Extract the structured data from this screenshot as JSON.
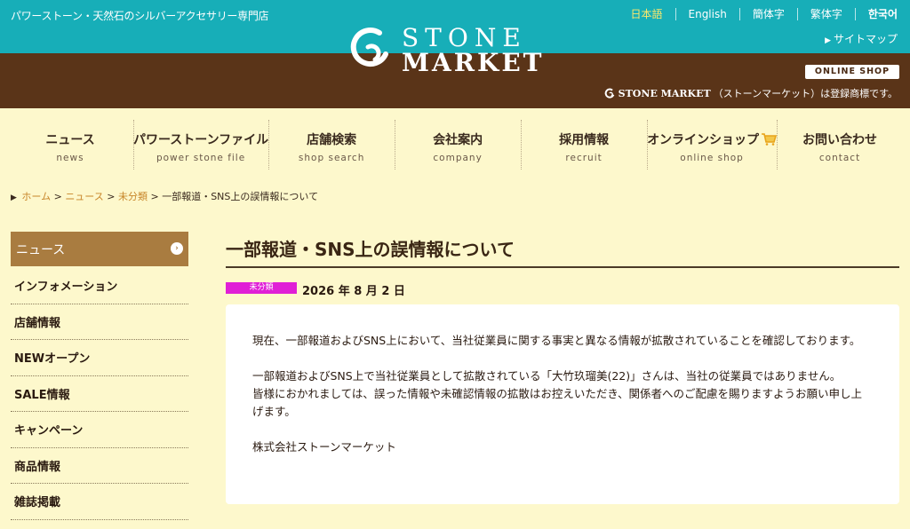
{
  "header": {
    "tagline": "パワーストーン・天然石のシルバーアクセサリー専門店",
    "languages": [
      "日本語",
      "English",
      "簡体字",
      "繁体字",
      "한국어"
    ],
    "sitemap": "サイトマップ",
    "logo_line1": "STONE",
    "logo_line2": "MARKET",
    "online_shop": "ONLINE SHOP",
    "trademark_logo": "STONE MARKET",
    "trademark_text": "（ストーンマーケット）は登録商標です。"
  },
  "nav": [
    {
      "jp": "ニュース",
      "en": "news"
    },
    {
      "jp": "パワーストーンファイル",
      "en": "power stone file"
    },
    {
      "jp": "店舗検索",
      "en": "shop search"
    },
    {
      "jp": "会社案内",
      "en": "company"
    },
    {
      "jp": "採用情報",
      "en": "recruit"
    },
    {
      "jp": "オンラインショップ",
      "en": "online shop"
    },
    {
      "jp": "お問い合わせ",
      "en": "contact"
    }
  ],
  "breadcrumb": {
    "home": "ホーム",
    "news": "ニュース",
    "category": "未分類",
    "current": "一部報道・SNS上の誤情報について",
    "separator": ">"
  },
  "sidebar": {
    "active": "ニュース",
    "items": [
      "インフォメーション",
      "店舗情報",
      "NEWオープン",
      "SALE情報",
      "キャンペーン",
      "商品情報",
      "雑誌掲載"
    ]
  },
  "article": {
    "title": "一部報道・SNS上の誤情報について",
    "category": "未分類",
    "date": "2026 年 8 月 2 日",
    "p1": "現在、一部報道およびSNS上において、当社従業員に関する事実と異なる情報が拡散されていることを確認しております。",
    "p2a": "一部報道およびSNS上で当社従業員として拡散されている「大竹玖瑠美(22)」さんは、当社の従業員ではありません。",
    "p2b": "皆様におかれましては、誤った情報や未確認情報の拡散はお控えいただき、関係者へのご配慮を賜りますようお願い申し上げます。",
    "signature": "株式会社ストーンマーケット"
  },
  "colors": {
    "teal": "#17aeb8",
    "brown": "#5a3418",
    "cream": "#fdf8cc",
    "sidebar_active": "#a97c40",
    "badge": "#e01fd6",
    "link": "#c8862a"
  }
}
